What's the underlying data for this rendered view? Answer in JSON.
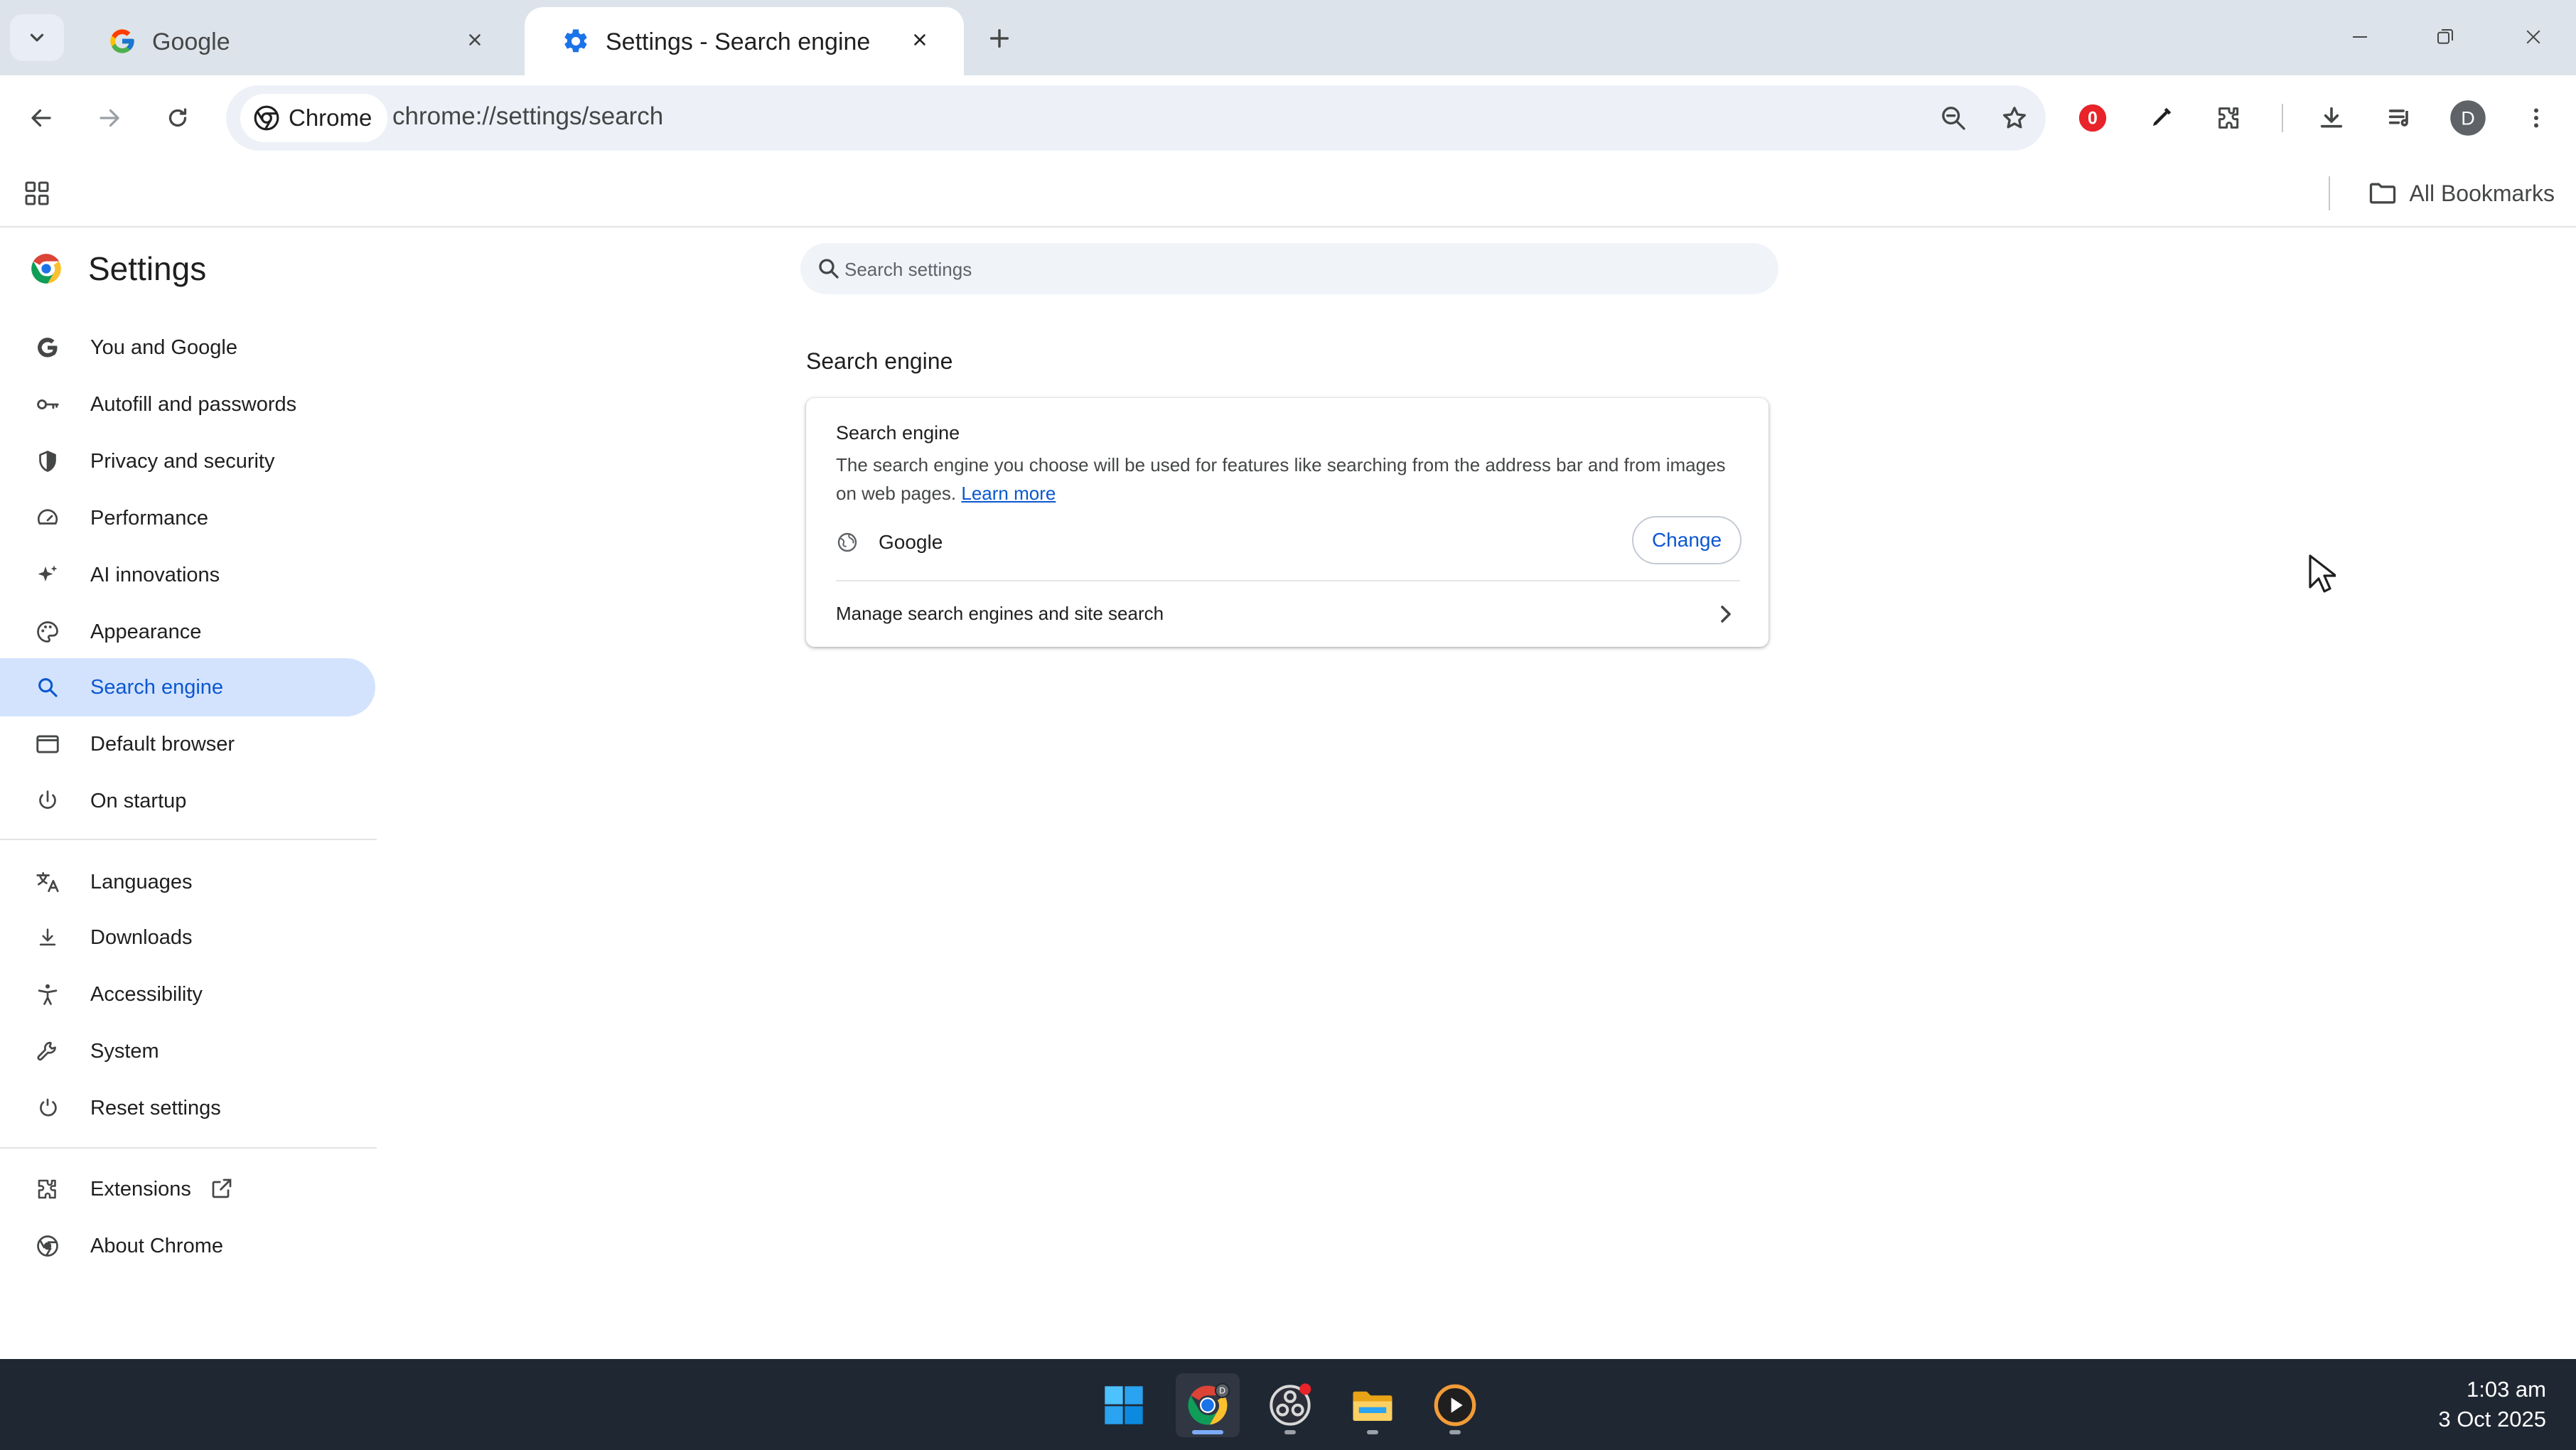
{
  "tabs": [
    {
      "title": "Google",
      "icon": "google-g-icon"
    },
    {
      "title": "Settings - Search engine",
      "icon": "gear-icon"
    }
  ],
  "toolbar": {
    "chip_label": "Chrome",
    "url": "chrome://settings/search",
    "profile_initial": "D",
    "extension_badge": "0"
  },
  "bookmarks": {
    "all_bookmarks": "All Bookmarks"
  },
  "sidebar": {
    "title": "Settings",
    "items": [
      {
        "label": "You and Google",
        "icon": "google-g-icon"
      },
      {
        "label": "Autofill and passwords",
        "icon": "key-icon"
      },
      {
        "label": "Privacy and security",
        "icon": "shield-icon"
      },
      {
        "label": "Performance",
        "icon": "speedometer-icon"
      },
      {
        "label": "AI innovations",
        "icon": "sparkle-icon"
      },
      {
        "label": "Appearance",
        "icon": "palette-icon"
      },
      {
        "label": "Search engine",
        "icon": "search-icon",
        "active": true
      },
      {
        "label": "Default browser",
        "icon": "browser-window-icon"
      },
      {
        "label": "On startup",
        "icon": "power-icon"
      },
      {
        "label": "Languages",
        "icon": "translate-icon"
      },
      {
        "label": "Downloads",
        "icon": "download-icon"
      },
      {
        "label": "Accessibility",
        "icon": "accessibility-icon"
      },
      {
        "label": "System",
        "icon": "wrench-icon"
      },
      {
        "label": "Reset settings",
        "icon": "reset-icon"
      },
      {
        "label": "Extensions",
        "icon": "puzzle-icon"
      },
      {
        "label": "About Chrome",
        "icon": "chrome-icon"
      }
    ]
  },
  "main": {
    "search_placeholder": "Search settings",
    "section_title": "Search engine",
    "card": {
      "title": "Search engine",
      "description": "The search engine you choose will be used for features like searching from the address bar and from images on web pages.",
      "learn_more": "Learn more",
      "engine_name": "Google",
      "change_label": "Change",
      "manage_label": "Manage search engines and site search"
    }
  },
  "taskbar": {
    "time": "1:03 am",
    "date": "3 Oct 2025",
    "chrome_badge": "D"
  },
  "colors": {
    "accent": "#0b57d0",
    "active_nav_bg": "#d3e3fd",
    "tabstrip_bg": "#dde3ea",
    "taskbar_bg": "#1f2733"
  }
}
